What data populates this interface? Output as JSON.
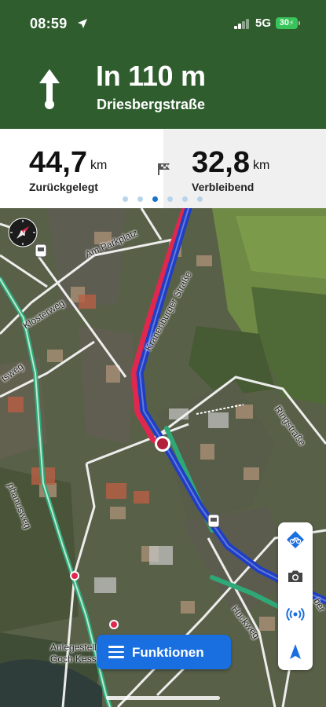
{
  "status_bar": {
    "time": "08:59",
    "network": "5G",
    "battery": "30"
  },
  "navigation": {
    "distance": "In 110 m",
    "street": "Driesbergstraße",
    "direction_icon": "arrow-straight-icon"
  },
  "stats": {
    "travelled": {
      "value": "44,7",
      "unit": "km",
      "label": "Zurückgelegt"
    },
    "remaining": {
      "value": "32,8",
      "unit": "km",
      "label": "Verbleibend"
    },
    "page_count": 6,
    "active_page": 3
  },
  "map": {
    "labels": {
      "am_parkplatz": "Am Parkplatz",
      "klosterweg": "Klosterweg",
      "tsweg": "tsweg",
      "kranenburger": "Kranenburger Straße",
      "ringstrasse": "Ringstraße",
      "phanusweg": "phanusweg",
      "huckweg": "Huckweg",
      "anlegestelle_1": "Anlegestell",
      "anlegestelle_2": "Goch Kesse",
      "ber": "ber"
    },
    "colors": {
      "route_blue": "#1f3ec4",
      "route_red": "#e0284f",
      "bike_path_green": "#2fa877"
    }
  },
  "toolbar": {
    "items": [
      "bike-route-icon",
      "camera-icon",
      "broadcast-icon",
      "navigation-arrow-icon"
    ]
  },
  "functions_button": {
    "label": "Funktionen"
  }
}
